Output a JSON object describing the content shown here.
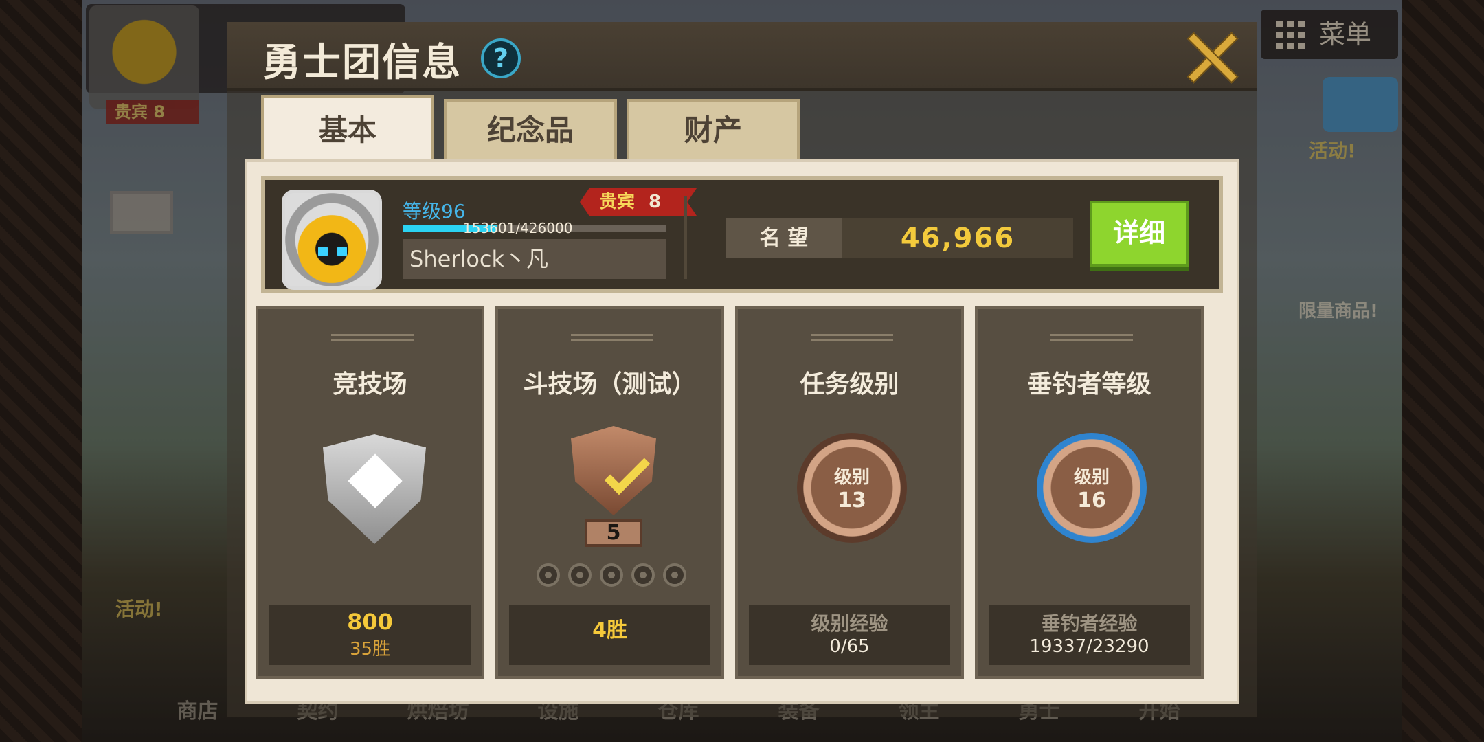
{
  "background": {
    "vip_label": "贵宾 8",
    "menu_label": "菜单",
    "event_labels": [
      "活动!",
      "活动!"
    ],
    "limit_label": "限量商品!",
    "bottom_nav": [
      "商店",
      "契约",
      "烘焙坊",
      "设施",
      "仓库",
      "装备",
      "领主",
      "勇士"
    ],
    "start_label": "开始"
  },
  "dialog": {
    "title": "勇士团信息",
    "help_icon": "?",
    "tabs": [
      {
        "label": "基本",
        "active": true
      },
      {
        "label": "纪念品",
        "active": false
      },
      {
        "label": "财产",
        "active": false
      }
    ]
  },
  "profile": {
    "level_label": "等级96",
    "vip_text": "贵宾",
    "vip_level": "8",
    "exp_text": "153601/426000",
    "exp_current": 153601,
    "exp_max": 426000,
    "name": "Sherlock丶凡",
    "fame_label": "名 望",
    "fame_value": "46,966",
    "detail_label": "详细"
  },
  "cards": [
    {
      "title": "竞技场",
      "line1": "800",
      "line2": "35胜",
      "icon": "silver-shield-icon"
    },
    {
      "title": "斗技场（测试）",
      "rank": "5",
      "line1": "4胜",
      "icon": "bronze-shield-icon",
      "dots": 5
    },
    {
      "title": "任务级别",
      "medal_label": "级别",
      "medal_level": "13",
      "line1": "级别经验",
      "line2": "0/65",
      "icon": "quest-medal-icon"
    },
    {
      "title": "垂钓者等级",
      "medal_label": "级别",
      "medal_level": "16",
      "line1": "垂钓者经验",
      "line2": "19337/23290",
      "icon": "fishing-medal-icon"
    }
  ],
  "colors": {
    "gold": "#f5c93a",
    "detail_green": "#8ed52e",
    "level_blue": "#45b5e8",
    "vip_red": "#b3241d"
  }
}
